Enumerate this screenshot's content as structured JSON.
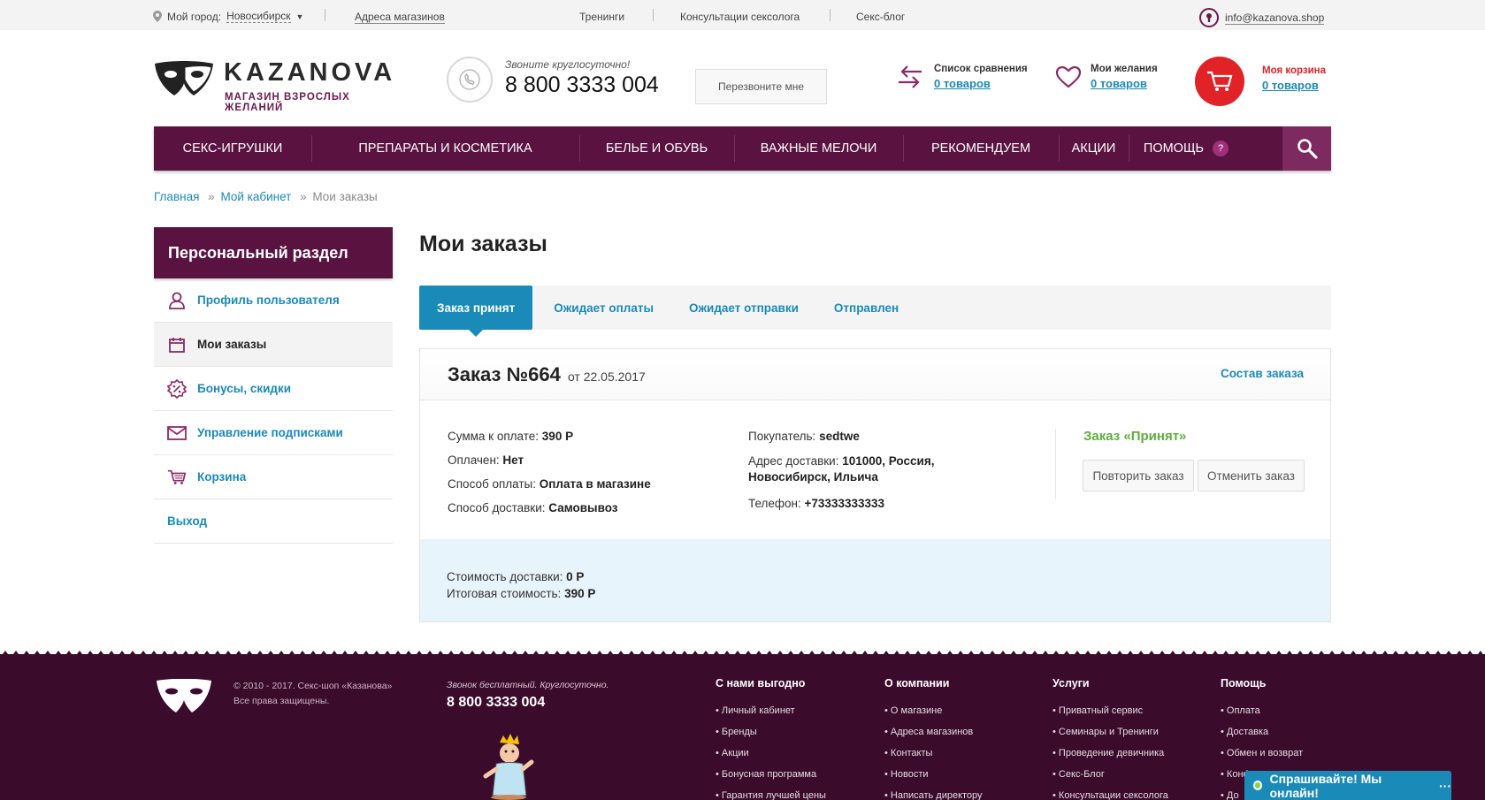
{
  "topbar": {
    "city_label": "Мой город:",
    "city_value": "Новосибирск",
    "stores": "Адреса магазинов",
    "trainings": "Тренинги",
    "consult": "Консультации сексолога",
    "blog": "Секс-блог",
    "email": "info@kazanova.shop"
  },
  "header": {
    "logo_name": "KAZANOVA",
    "logo_tagline": "МАГАЗИН ВЗРОСЛЫХ ЖЕЛАНИЙ",
    "call_note": "Звоните круглосуточно!",
    "phone": "8 800 3333 004",
    "callback": "Перезвоните мне",
    "compare_label": "Список сравнения",
    "compare_count": "0 товаров",
    "wish_label": "Мои желания",
    "wish_count": "0 товаров",
    "cart_label": "Моя корзина",
    "cart_count": "0 товаров"
  },
  "nav": {
    "items": [
      "СЕКС-ИГРУШКИ",
      "ПРЕПАРАТЫ И КОСМЕТИКА",
      "БЕЛЬЕ И ОБУВЬ",
      "ВАЖНЫЕ МЕЛОЧИ",
      "РЕКОМЕНДУЕМ",
      "АКЦИИ",
      "ПОМОЩЬ"
    ],
    "help_badge": "?"
  },
  "breadcrumb": {
    "home": "Главная",
    "sep": "»",
    "cabinet": "Мой кабинет",
    "current": "Мои заказы"
  },
  "sidebar": {
    "title": "Персональный раздел",
    "items": [
      {
        "label": "Профиль пользователя",
        "icon": "user-icon"
      },
      {
        "label": "Мои заказы",
        "icon": "calendar-icon"
      },
      {
        "label": "Бонусы, скидки",
        "icon": "discount-icon"
      },
      {
        "label": "Управление подписками",
        "icon": "envelope-icon"
      },
      {
        "label": "Корзина",
        "icon": "cart-icon"
      },
      {
        "label": "Выход"
      }
    ]
  },
  "main": {
    "title": "Мои заказы",
    "tabs": [
      "Заказ принят",
      "Ожидает оплаты",
      "Ожидает отправки",
      "Отправлен"
    ]
  },
  "order": {
    "number": "Заказ №664",
    "date": "от 22.05.2017",
    "details_link": "Состав заказа",
    "sum_label": "Сумма к оплате:",
    "sum_value": "390 Р",
    "paid_label": "Оплачен:",
    "paid_value": "Нет",
    "pay_method_label": "Способ оплаты:",
    "pay_method_value": "Оплата в магазине",
    "delivery_method_label": "Способ доставки:",
    "delivery_method_value": "Самовывоз",
    "buyer_label": "Покупатель:",
    "buyer_value": "sedtwe",
    "address_label": "Адрес доставки:",
    "address_value_1": "101000, Россия,",
    "address_value_2": "Новосибирск, Ильича",
    "phone_label": "Телефон:",
    "phone_value": "+73333333333",
    "status": "Заказ «Принят»",
    "repeat_button": "Повторить заказ",
    "cancel_button": "Отменить заказ",
    "delivery_cost_label": "Стоимость доставки:",
    "delivery_cost_value": "0 Р",
    "total_label": "Итоговая стоимость:",
    "total_value": "390 Р"
  },
  "footer": {
    "copyright_1": "© 2010 - 2017. Секс-шоп «Казанова»",
    "copyright_2": "Все права защищены.",
    "call_note": "Звонок бесплатный. Круглосуточно.",
    "phone": "8 800 3333 004",
    "columns": [
      {
        "title": "С нами выгодно",
        "links": [
          "Личный кабинет",
          "Бренды",
          "Акции",
          "Бонусная программа",
          "Гарантия лучшей цены"
        ]
      },
      {
        "title": "О компании",
        "links": [
          "О магазине",
          "Адреса магазинов",
          "Контакты",
          "Новости",
          "Написать директору"
        ]
      },
      {
        "title": "Услуги",
        "links": [
          "Приватный сервис",
          "Семинары и Тренинги",
          "Проведение девичника",
          "Секс-Блог",
          "Консультации сексолога"
        ]
      },
      {
        "title": "Помощь",
        "links": [
          "Оплата",
          "Доставка",
          "Обмен и возврат",
          "Конфиденциальность",
          "До"
        ]
      }
    ]
  },
  "chat": {
    "label": "Спрашивайте! Мы онлайн!",
    "dots": "···"
  },
  "colors": {
    "brand": "#5a1240",
    "accent": "#1a8ab8",
    "cart": "#e12227",
    "status_ok": "#5cae3a"
  }
}
